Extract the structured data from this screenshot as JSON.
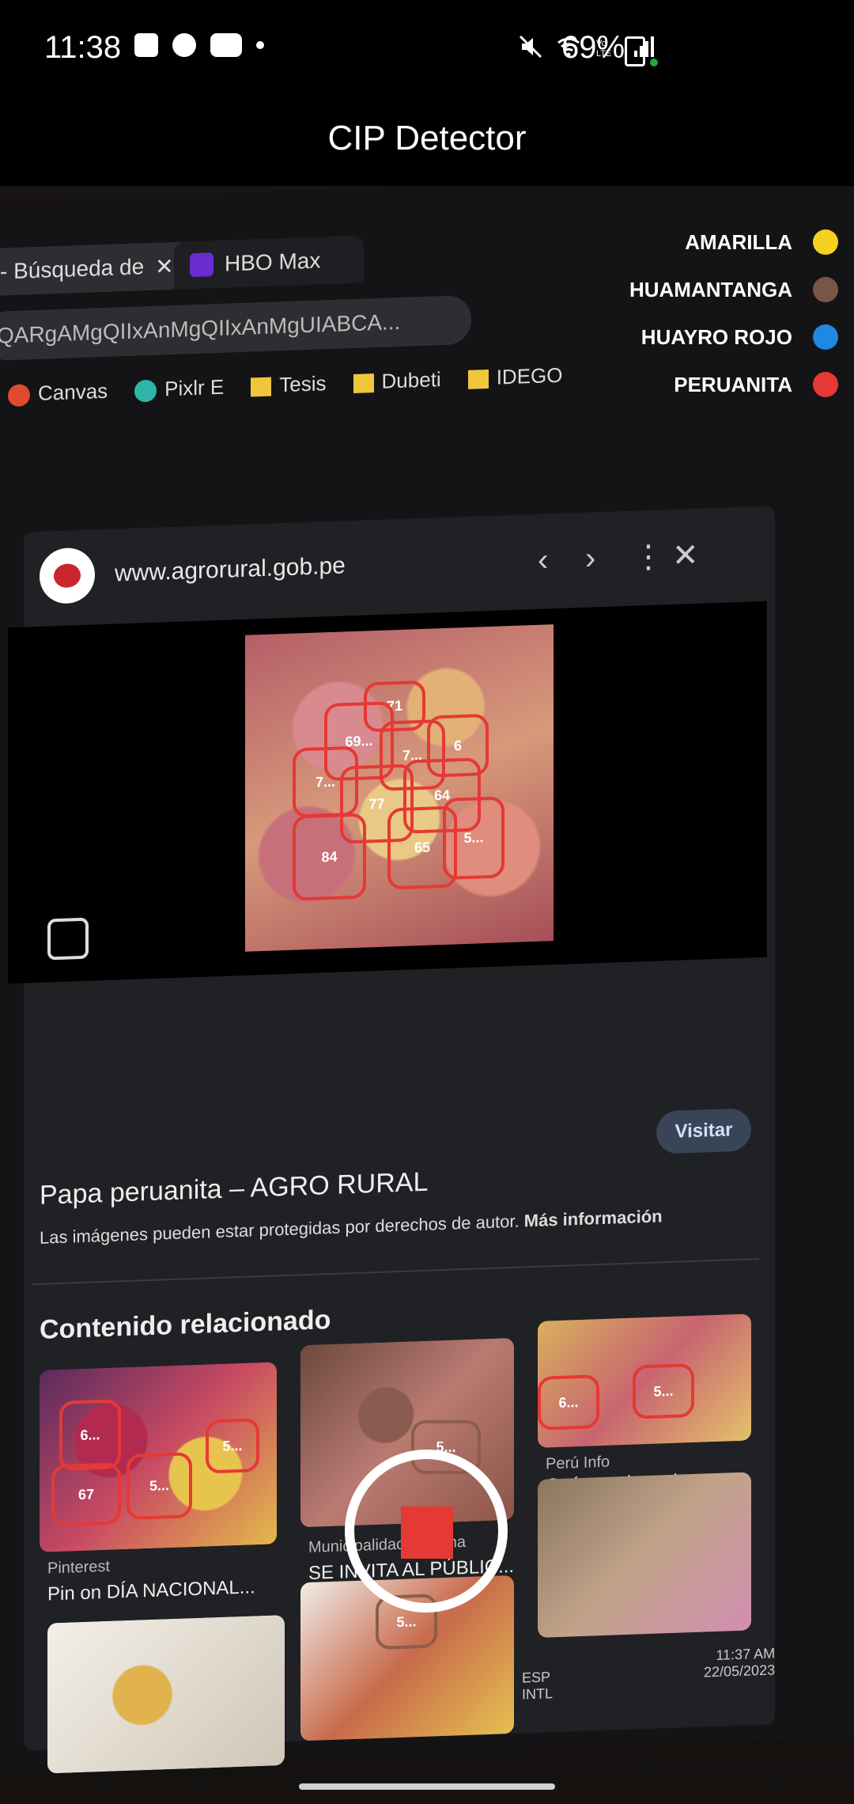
{
  "status_bar": {
    "time": "11:38",
    "battery_percent": "69%",
    "left_icons": [
      "screenshot-icon",
      "soccer-icon",
      "youtube-icon",
      "dot-icon"
    ],
    "right_icons": [
      "mute-icon",
      "wifi-icon",
      "volte-icon",
      "signal-icon",
      "battery-icon"
    ]
  },
  "app": {
    "title": "CIP Detector"
  },
  "legend": [
    {
      "label": "AMARILLA",
      "color": "#f4d21f"
    },
    {
      "label": "HUAMANTANGA",
      "color": "#7a5546"
    },
    {
      "label": "HUAYRO ROJO",
      "color": "#1e88e5"
    },
    {
      "label": "PERUANITA",
      "color": "#e53935"
    }
  ],
  "browser": {
    "tabs": [
      {
        "label": "- Búsqueda de"
      },
      {
        "label": "HBO Max"
      }
    ],
    "url_fragment": "QARgAMgQIIxAnMgQIIxAnMgUIABCA...",
    "bookmarks": [
      "Canvas",
      "Pixlr E",
      "Tesis",
      "Dubeti",
      "IDEGO"
    ],
    "panel": {
      "site_url": "www.agrorural.gob.pe",
      "result_title": "Papa peruanita – AGRO RURAL",
      "result_note": "Las imágenes pueden estar protegidas por derechos de autor.",
      "result_note_link": "Más información",
      "visit_button": "Visitar",
      "related_heading": "Contenido relacionado",
      "related_items": [
        {
          "source": "Pinterest",
          "title": "Pin on DÍA NACIONAL..."
        },
        {
          "source": "Municipalidad de Lima",
          "title": "SE INVITA AL PÚBLIC..."
        },
        {
          "source": "Perú Info",
          "title": "Cuántos tipos de papa..."
        }
      ]
    },
    "taskbar": {
      "lang": "ESP",
      "lang2": "INTL",
      "time": "11:37 AM",
      "date": "22/05/2023"
    }
  },
  "detections_preview": [
    "71",
    "69...",
    "7...",
    "6",
    "7...",
    "77",
    "64",
    "84",
    "65",
    "5..."
  ],
  "detections_related": [
    "6...",
    "67",
    "5...",
    "5...",
    "6...",
    "5...",
    "5..."
  ],
  "detection_recent": "5..."
}
